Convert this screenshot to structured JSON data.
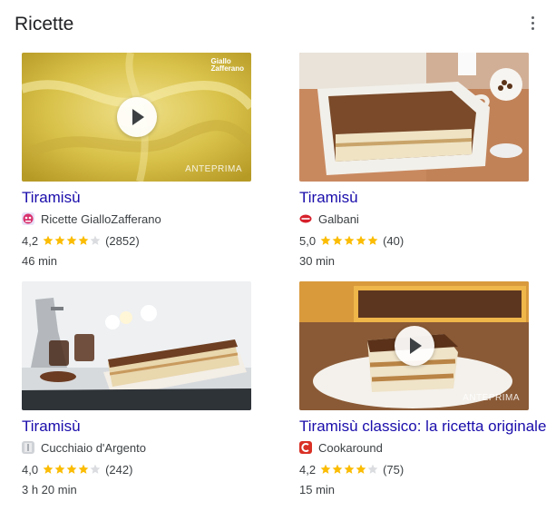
{
  "header": {
    "title": "Ricette"
  },
  "colors": {
    "link": "#1a0dab",
    "star": "#fbbc04",
    "star_empty": "#dadce0",
    "text": "#3c4043"
  },
  "recipes": [
    {
      "title": "Tiramisù",
      "source": "Ricette GialloZafferano",
      "source_icon": "giallozafferano-icon",
      "rating": "4,2",
      "rating_value": 4.2,
      "reviews": "(2852)",
      "time": "46 min",
      "thumb": {
        "video": true,
        "badge": "ANTEPRIMA",
        "watermark": "Giallo Zafferano"
      }
    },
    {
      "title": "Tiramisù",
      "source": "Galbani",
      "source_icon": "galbani-icon",
      "rating": "5,0",
      "rating_value": 5.0,
      "reviews": "(40)",
      "time": "30 min",
      "thumb": {
        "video": false
      }
    },
    {
      "title": "Tiramisù",
      "source": "Cucchiaio d'Argento",
      "source_icon": "cucchiaio-icon",
      "rating": "4,0",
      "rating_value": 4.0,
      "reviews": "(242)",
      "time": "3 h 20 min",
      "thumb": {
        "video": false
      }
    },
    {
      "title": "Tiramisù classico: la ricetta originale",
      "source": "Cookaround",
      "source_icon": "cookaround-icon",
      "rating": "4,2",
      "rating_value": 4.2,
      "reviews": "(75)",
      "time": "15 min",
      "thumb": {
        "video": true,
        "badge": "ANTEPRIMA"
      }
    }
  ]
}
